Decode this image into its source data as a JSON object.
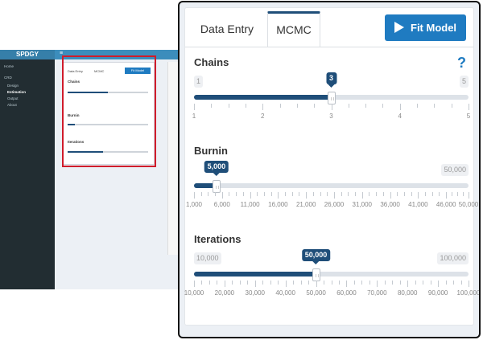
{
  "thumb": {
    "logo": "SPDGY",
    "menu": [
      "Home",
      "CRD",
      "Design",
      "Estimation",
      "Output",
      "About"
    ],
    "mini_tabs": [
      "Data Entry",
      "MCMC"
    ],
    "mini_fit": "Fit Model",
    "mini_labels": [
      "Chains",
      "Burnin",
      "Iterations"
    ]
  },
  "tabs": [
    {
      "label": "Data Entry",
      "active": false
    },
    {
      "label": "MCMC",
      "active": true
    }
  ],
  "fit_button": {
    "label": "Fit Model"
  },
  "help_icon": "?",
  "sliders": [
    {
      "label": "Chains",
      "min": 1,
      "max": 5,
      "value": 3,
      "min_label": "1",
      "max_label": "5",
      "value_label": "3",
      "tick_labels": [
        "1",
        "2",
        "3",
        "4",
        "5"
      ],
      "tick_values": [
        1,
        2,
        3,
        4,
        5
      ]
    },
    {
      "label": "Burnin",
      "min": 1000,
      "max": 50000,
      "value": 5000,
      "min_label": "",
      "max_label": "50,000",
      "value_label": "5,000",
      "tick_labels": [
        "1,000",
        "6,000",
        "11,000",
        "16,000",
        "21,000",
        "26,000",
        "31,000",
        "36,000",
        "41,000",
        "46,000",
        "50,000"
      ],
      "tick_values": [
        1000,
        6000,
        11000,
        16000,
        21000,
        26000,
        31000,
        36000,
        41000,
        46000,
        50000
      ]
    },
    {
      "label": "Iterations",
      "min": 10000,
      "max": 100000,
      "value": 50000,
      "min_label": "10,000",
      "max_label": "100,000",
      "value_label": "50,000",
      "tick_labels": [
        "10,000",
        "20,000",
        "30,000",
        "40,000",
        "50,000",
        "60,000",
        "70,000",
        "80,000",
        "90,000",
        "100,000"
      ],
      "tick_values": [
        10000,
        20000,
        30000,
        40000,
        50000,
        60000,
        70000,
        80000,
        90000,
        100000
      ]
    }
  ],
  "colors": {
    "accent": "#1f4e79",
    "button": "#1f7bc1",
    "highlight": "#d01c2b"
  }
}
